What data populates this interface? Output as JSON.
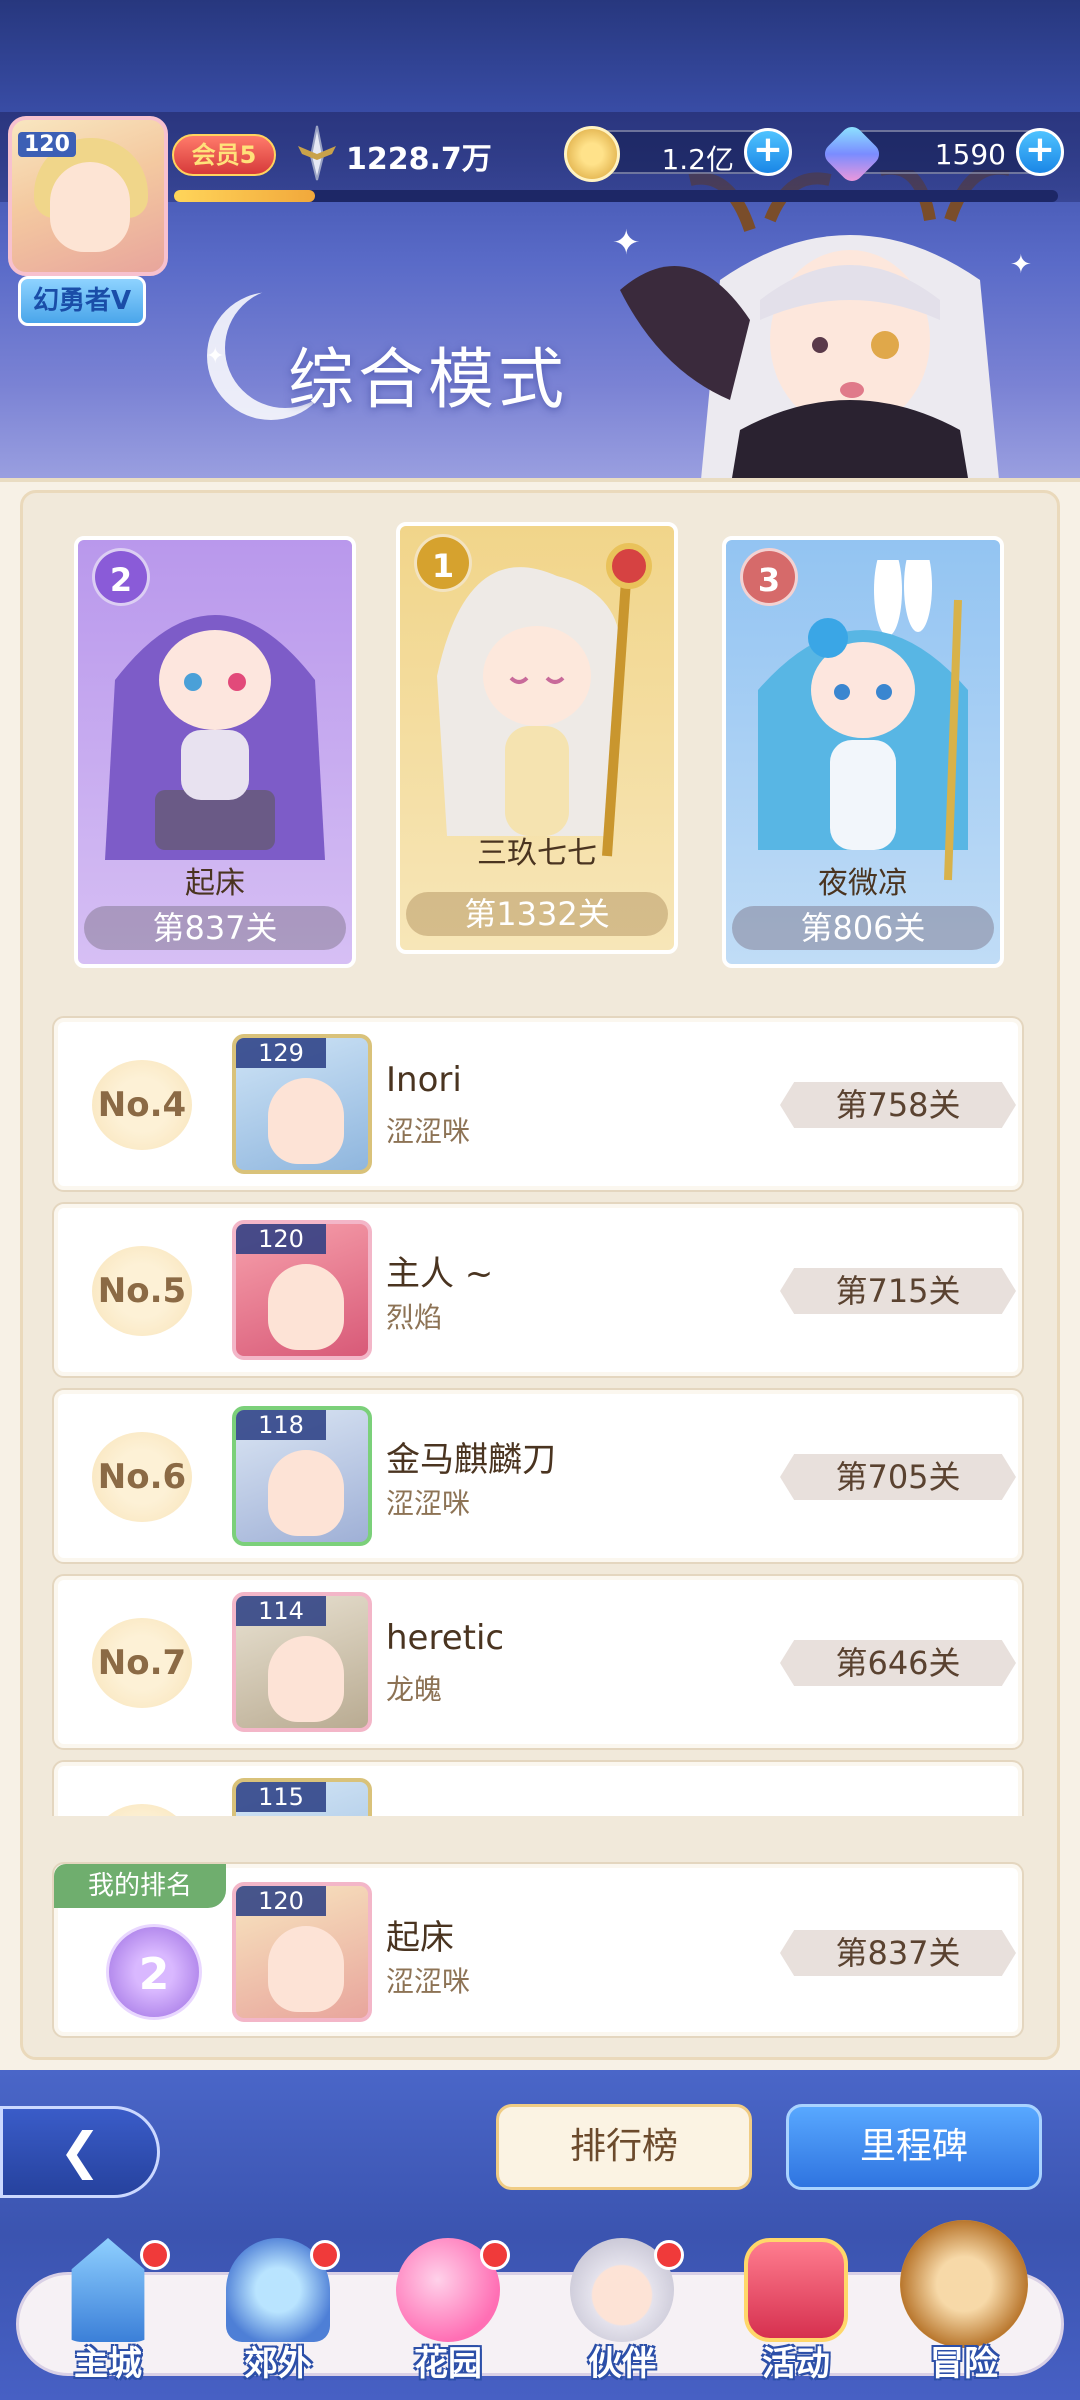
{
  "header": {
    "player_level": "120",
    "player_title": "幻勇者V",
    "vip": "会员5",
    "power": "1228.7万",
    "xp_progress": 0.16,
    "gold": "1.2亿",
    "gems": "1590",
    "mode_title": "综合模式"
  },
  "podium": [
    {
      "rank": "2",
      "name": "起床",
      "stage": "第837关"
    },
    {
      "rank": "1",
      "name": "三玖七七",
      "stage": "第1332关"
    },
    {
      "rank": "3",
      "name": "夜微凉",
      "stage": "第806关"
    }
  ],
  "rankings": [
    {
      "no": "No.4",
      "level": "129",
      "name": "Inori",
      "guild": "涩涩咪",
      "stage": "第758关"
    },
    {
      "no": "No.5",
      "level": "120",
      "name": "主人 ~",
      "guild": "烈焰",
      "stage": "第715关"
    },
    {
      "no": "No.6",
      "level": "118",
      "name": "金马麒麟刀",
      "guild": "涩涩咪",
      "stage": "第705关"
    },
    {
      "no": "No.7",
      "level": "114",
      "name": "heretic",
      "guild": "龙魄",
      "stage": "第646关"
    },
    {
      "no": "",
      "level": "115",
      "name": "",
      "guild": "",
      "stage": ""
    }
  ],
  "my_rank": {
    "tag": "我的排名",
    "rank": "2",
    "level": "120",
    "name": "起床",
    "guild": "涩涩咪",
    "stage": "第837关"
  },
  "actions": {
    "leaderboard": "排行榜",
    "milestone": "里程碑"
  },
  "nav": [
    {
      "label": "主城",
      "icon": "castle-icon"
    },
    {
      "label": "郊外",
      "icon": "portal-icon"
    },
    {
      "label": "花园",
      "icon": "heart-icon"
    },
    {
      "label": "伙伴",
      "icon": "partner-icon"
    },
    {
      "label": "活动",
      "icon": "gift-icon"
    },
    {
      "label": "冒险",
      "icon": "compass-icon"
    }
  ],
  "colors": {
    "header_bg": "#3a4ea8",
    "panel_bg": "#f1e9da",
    "rank1_card": "#f3dd9c",
    "rank2_card": "#c8a8f0",
    "rank3_card": "#a8cff5"
  }
}
